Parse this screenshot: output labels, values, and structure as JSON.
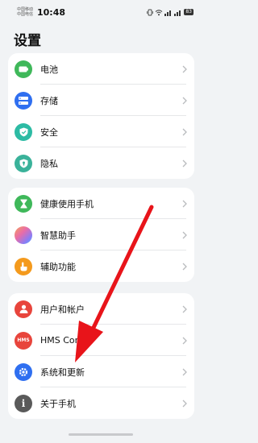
{
  "status_bar": {
    "carrier_1": "中国移动",
    "carrier_2": "中国电信",
    "time": "10:48",
    "battery": "83"
  },
  "page": {
    "title": "设置"
  },
  "groups": [
    {
      "items": [
        {
          "label": "电池",
          "icon": "battery-icon",
          "color": "#3fb85a"
        },
        {
          "label": "存储",
          "icon": "storage-icon",
          "color": "#2f6ff0"
        },
        {
          "label": "安全",
          "icon": "shield-check-icon",
          "color": "#2dbba4"
        },
        {
          "label": "隐私",
          "icon": "privacy-lock-icon",
          "color": "#3ab29a"
        }
      ]
    },
    {
      "items": [
        {
          "label": "健康使用手机",
          "icon": "hourglass-icon",
          "color": "#3fb85a"
        },
        {
          "label": "智慧助手",
          "icon": "assistant-orb-icon",
          "color": "#8a7cf5"
        },
        {
          "label": "辅助功能",
          "icon": "hand-icon",
          "color": "#f49a1d"
        }
      ]
    },
    {
      "items": [
        {
          "label": "用户和帐户",
          "icon": "user-icon",
          "color": "#e8453c"
        },
        {
          "label": "HMS Core",
          "icon": "hms-icon",
          "color": "#e8453c",
          "badge": "HMS"
        },
        {
          "label": "系统和更新",
          "icon": "system-gear-icon",
          "color": "#2f6ff0"
        },
        {
          "label": "关于手机",
          "icon": "info-icon",
          "color": "#5a5a5a",
          "badge": "i"
        }
      ]
    }
  ],
  "annotation": {
    "color": "#e8141a"
  }
}
